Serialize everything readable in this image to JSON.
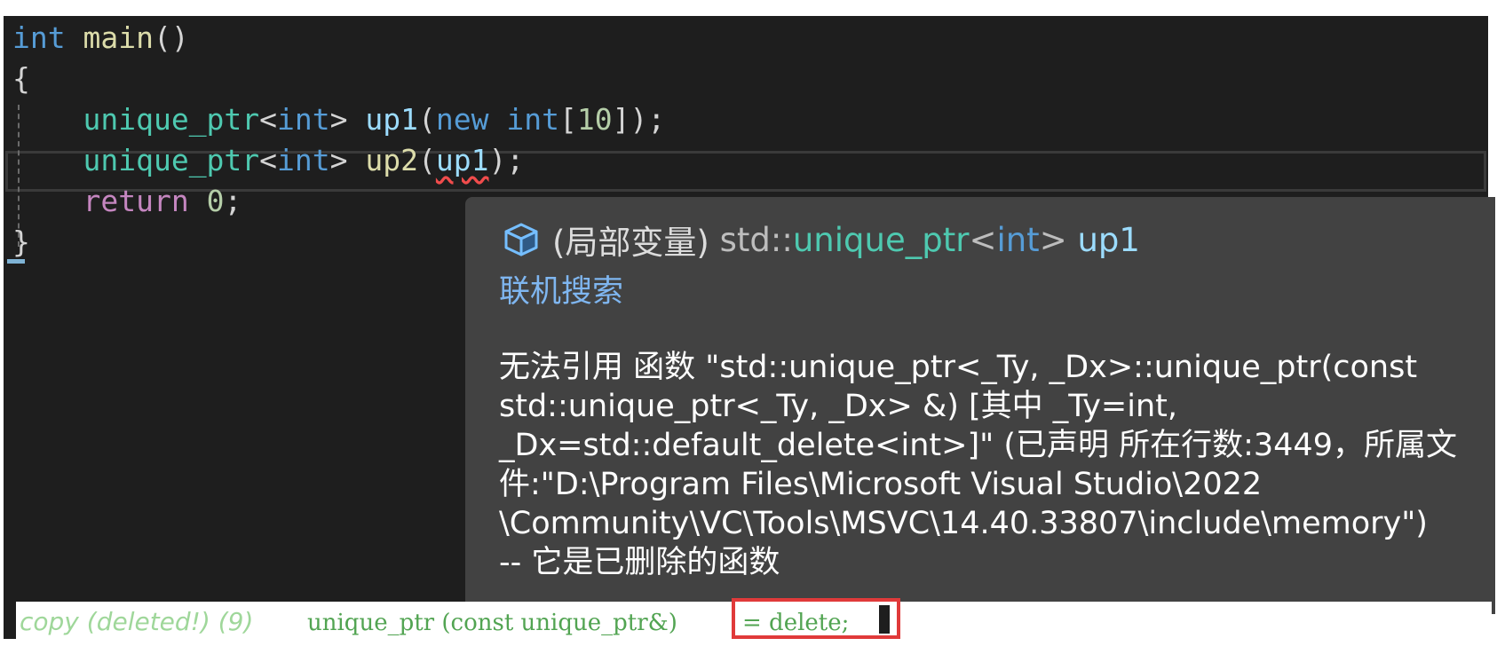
{
  "code": {
    "line1": {
      "kw_int": "int",
      "fn_main": "main",
      "parens": "()"
    },
    "line2": {
      "brace_open": "{"
    },
    "line3": {
      "type": "unique_ptr",
      "lt": "<",
      "kw": "int",
      "gt": ">",
      "var": "up1",
      "paren_open": "(",
      "kw_new": "new",
      "kw_int": "int",
      "bracket_open": "[",
      "num": "10",
      "bracket_close": "])",
      "semi": ";"
    },
    "line4": {
      "type": "unique_ptr",
      "lt": "<",
      "kw": "int",
      "gt": ">",
      "var": "up2",
      "paren_open": "(",
      "arg": "up1",
      "paren_close": ")",
      "semi": ";"
    },
    "line5": {
      "kw_return": "return",
      "num": "0",
      "semi": ";"
    },
    "line6": {
      "brace_close": "}"
    }
  },
  "tooltip": {
    "icon": "local-variable-cube-icon",
    "prefix": "(局部变量) ",
    "ns": "std::",
    "type": "unique_ptr",
    "lt": "<",
    "targ": "int",
    "gt": ">",
    "var": " up1",
    "search_link": "联机搜索",
    "message_lines": [
      "无法引用 函数 \"std::unique_ptr<_Ty, _Dx>::unique_ptr(const",
      "std::unique_ptr<_Ty, _Dx> &) [其中 _Ty=int,",
      "_Dx=std::default_delete<int>]\" (已声明 所在行数:3449，所属文",
      "件:\"D:\\Program Files\\Microsoft Visual Studio\\2022",
      "\\Community\\VC\\Tools\\MSVC\\14.40.33807\\include\\memory\")",
      "-- 它是已删除的函数"
    ]
  },
  "signature": {
    "name": "copy (deleted!) (9)",
    "decl": "unique_ptr (const unique_ptr&)",
    "deleted": "= delete;"
  },
  "colors": {
    "editor_bg": "#1e1e1e",
    "keyword": "#569cd6",
    "function": "#dcdcaa",
    "type": "#4ec9b0",
    "variable": "#9cdcfe",
    "number": "#b5cea8",
    "control": "#c586c0",
    "error_squiggle": "#f14c4c",
    "tooltip_bg": "#424242",
    "link": "#7fb6f0",
    "highlight_box": "#e03a3a"
  }
}
